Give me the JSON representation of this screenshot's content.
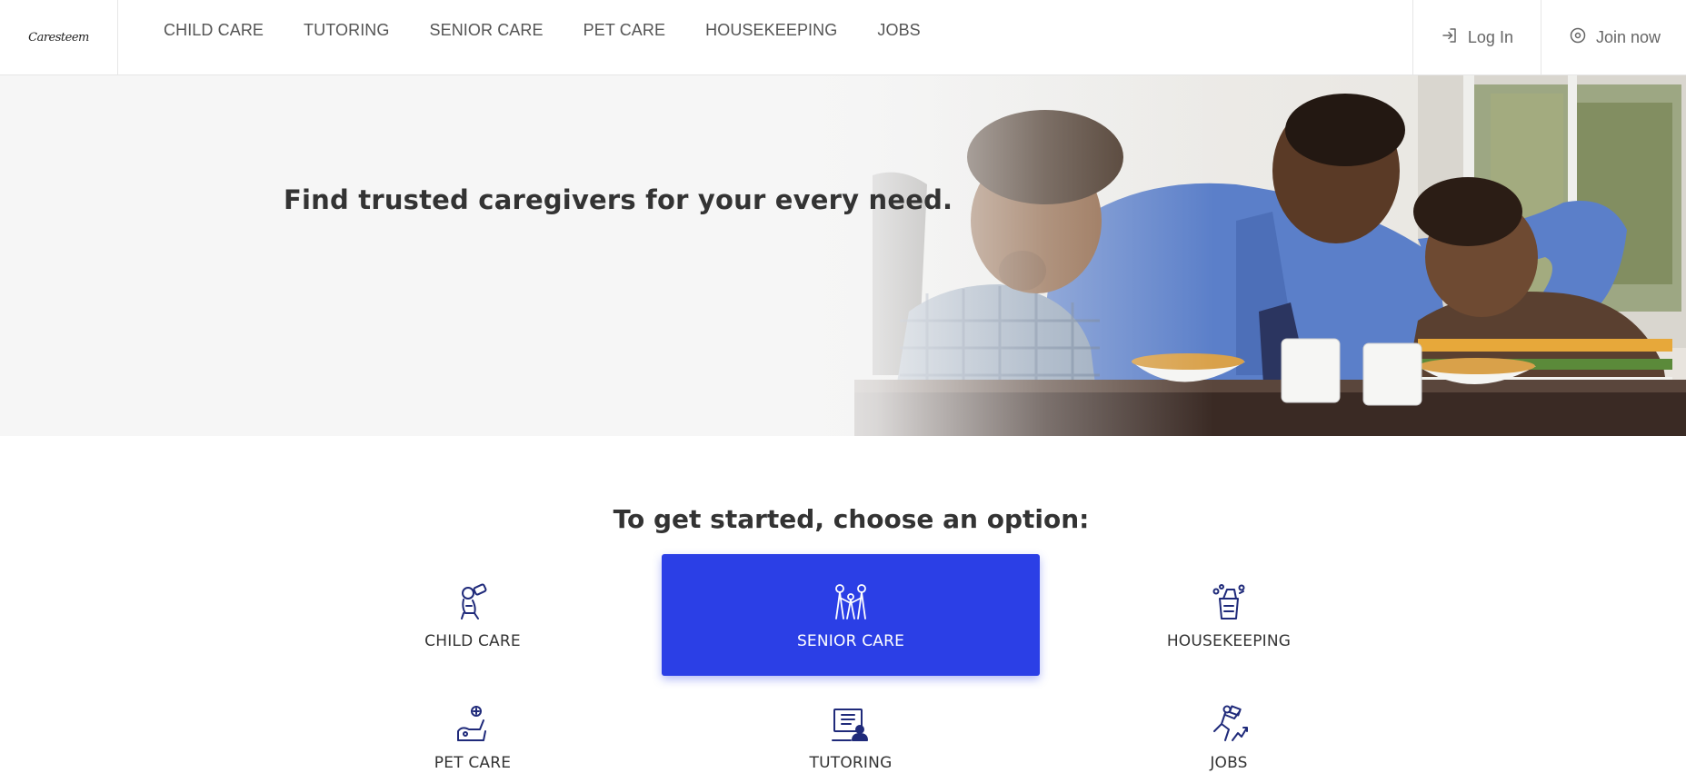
{
  "header": {
    "logo_text": "Caresteem",
    "nav": [
      "CHILD CARE",
      "TUTORING",
      "SENIOR CARE",
      "PET CARE",
      "HOUSEKEEPING",
      "JOBS"
    ],
    "login_label": "Log In",
    "join_label": "Join now"
  },
  "hero": {
    "title": "Find trusted caregivers for your every need."
  },
  "options": {
    "title": "To get started, choose an option:",
    "items": [
      {
        "label": "CHILD CARE",
        "icon": "child-care-icon",
        "active": false
      },
      {
        "label": "SENIOR CARE",
        "icon": "senior-care-icon",
        "active": true
      },
      {
        "label": "HOUSEKEEPING",
        "icon": "housekeeping-icon",
        "active": false
      },
      {
        "label": "PET CARE",
        "icon": "pet-care-icon",
        "active": false
      },
      {
        "label": "TUTORING",
        "icon": "tutoring-icon",
        "active": false
      },
      {
        "label": "JOBS",
        "icon": "jobs-icon",
        "active": false
      }
    ]
  },
  "colors": {
    "accent": "#2b3fe6",
    "icon_navy": "#1f2a7a",
    "text": "#333333"
  }
}
